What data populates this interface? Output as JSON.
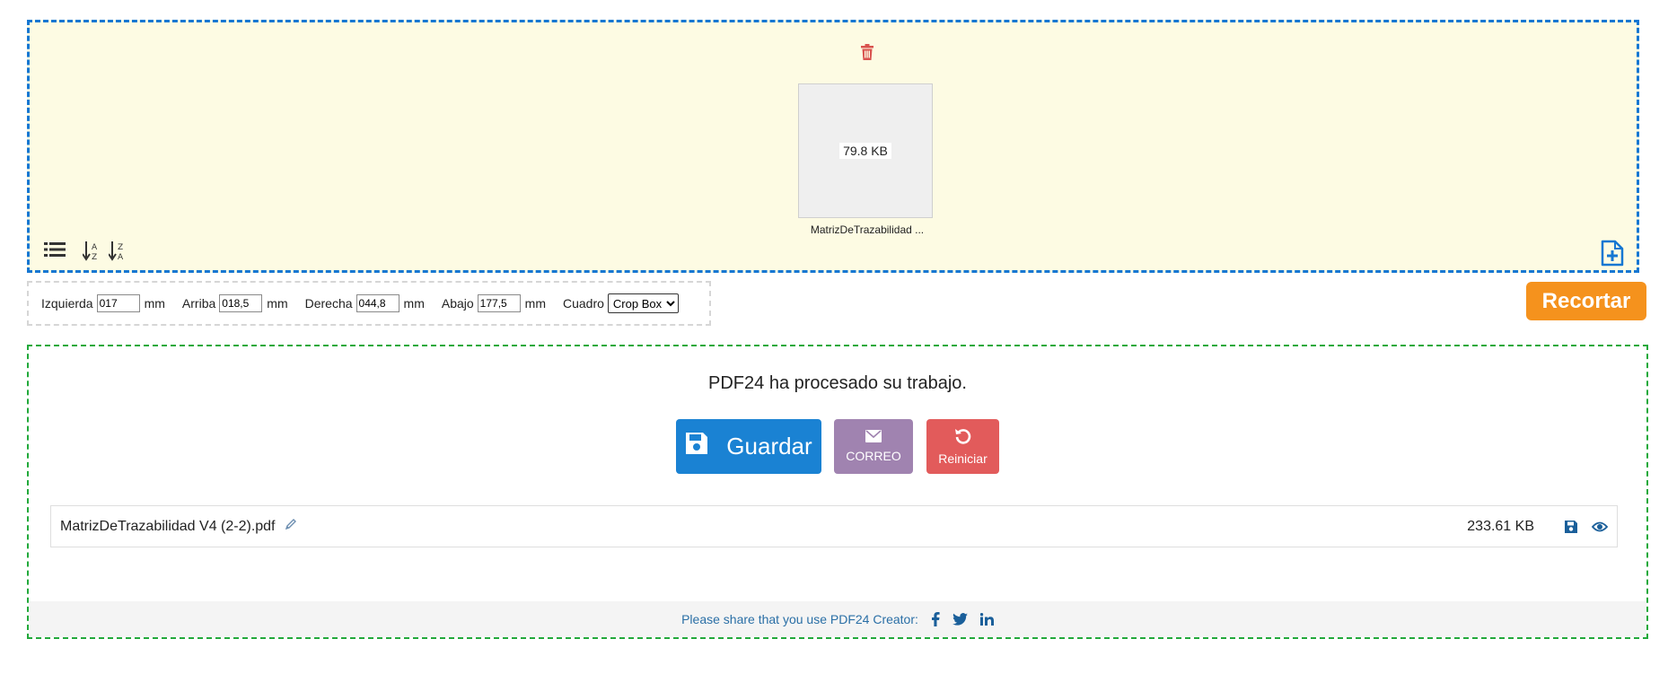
{
  "file_zone": {
    "file": {
      "size": "79.8 KB",
      "name": "MatrizDeTrazabilidad ..."
    },
    "icons": [
      "trash-icon",
      "list-view-icon",
      "sort-az-icon",
      "sort-za-icon",
      "add-file-icon"
    ]
  },
  "crop": {
    "left_label": "Izquierda",
    "left_value": "017",
    "top_label": "Arriba",
    "top_value": "018,5",
    "right_label": "Derecha",
    "right_value": "044,8",
    "bottom_label": "Abajo",
    "bottom_value": "177,5",
    "unit": "mm",
    "box_label": "Cuadro",
    "box_selected": "Crop Box",
    "button_label": "Recortar"
  },
  "result": {
    "title": "PDF24 ha procesado su trabajo.",
    "save_label": "Guardar",
    "mail_label": "CORREO",
    "reset_label": "Reiniciar",
    "file_name": "MatrizDeTrazabilidad V4 (2-2).pdf",
    "file_size": "233.61 KB",
    "share_text": "Please share that you use PDF24 Creator:"
  },
  "colors": {
    "accent_blue": "#1a82d3",
    "crop_orange": "#f5921d",
    "mail_purple": "#a083b0",
    "reset_red": "#e25b5b",
    "zone_yellow": "#fdfbe3",
    "result_green": "#22a93b"
  }
}
